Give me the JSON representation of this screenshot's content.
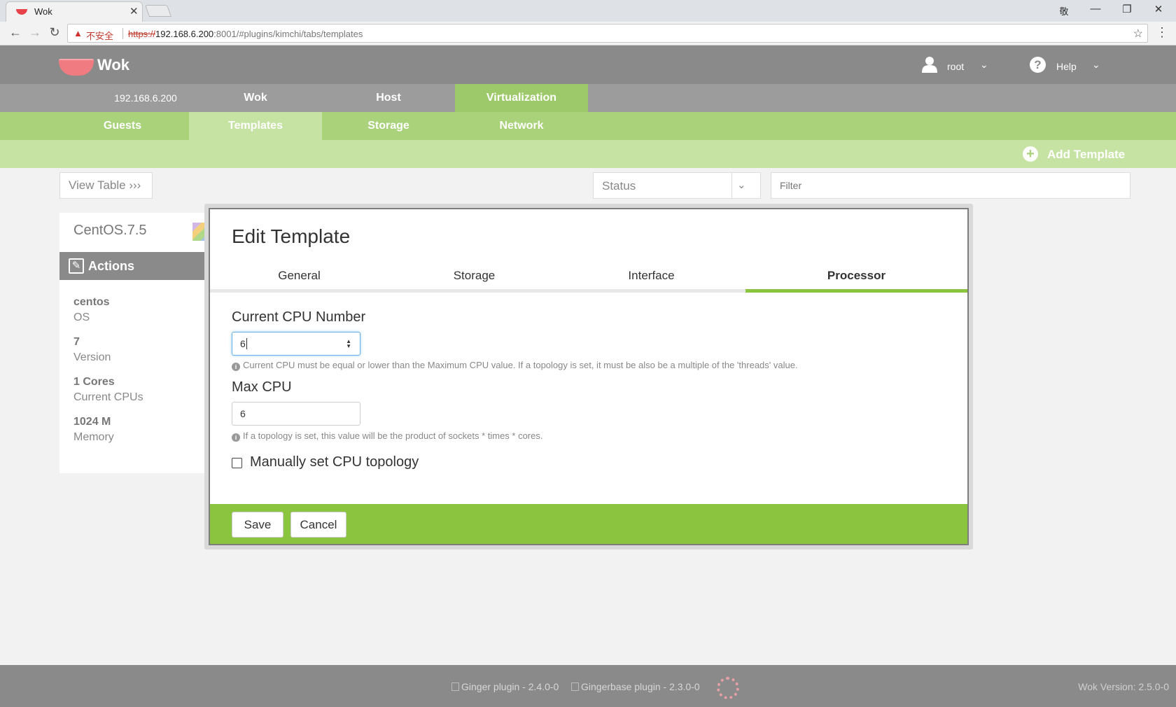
{
  "browser": {
    "tab_title": "Wok",
    "close_glyph": "✕",
    "user_glyph": "敬",
    "security_label": "不安全",
    "url_scheme": "https://",
    "url_host": "192.168.6.200",
    "url_rest": ":8001/#plugins/kimchi/tabs/templates"
  },
  "header": {
    "app_name": "Wok",
    "user": "root",
    "help": "Help"
  },
  "top_tabs": [
    {
      "label": "192.168.6.200"
    },
    {
      "label": "Wok"
    },
    {
      "label": "Host"
    },
    {
      "label": "Virtualization"
    }
  ],
  "sub_tabs": [
    {
      "label": "Guests"
    },
    {
      "label": "Templates"
    },
    {
      "label": "Storage"
    },
    {
      "label": "Network"
    }
  ],
  "toolbar": {
    "add_template": "Add Template"
  },
  "filters": {
    "view_table": "View Table ›››",
    "status_label": "Status",
    "filter_placeholder": "Filter"
  },
  "template_card": {
    "name": "CentOS.7.5",
    "actions_label": "Actions",
    "specs": [
      {
        "value": "centos",
        "label": "OS"
      },
      {
        "value": "7",
        "label": "Version"
      },
      {
        "value": "1 Cores",
        "label": "Current CPUs"
      },
      {
        "value": "1024 M",
        "label": "Memory"
      }
    ]
  },
  "modal": {
    "title": "Edit Template",
    "tabs": [
      {
        "label": "General"
      },
      {
        "label": "Storage"
      },
      {
        "label": "Interface"
      },
      {
        "label": "Processor"
      }
    ],
    "current_cpu_label": "Current CPU Number",
    "current_cpu_value": "6",
    "current_cpu_help": "Current CPU must be equal or lower than the Maximum CPU value. If a topology is set, it must be also be a multiple of the 'threads' value.",
    "max_cpu_label": "Max CPU",
    "max_cpu_value": "6",
    "max_cpu_help": "If a topology is set, this value will be the product of sockets * times * cores.",
    "topology_label": "Manually set CPU topology",
    "save_label": "Save",
    "cancel_label": "Cancel"
  },
  "footer": {
    "ginger": "Ginger plugin - 2.4.0-0",
    "gingerbase": "Gingerbase plugin - 2.3.0-0",
    "wok_version": "Wok Version: 2.5.0-0"
  },
  "colors": {
    "header_gray": "#8a8a8a",
    "nav_green": "#9ec96a",
    "sub_green": "#a9d27a",
    "light_green": "#c6e3a4",
    "accent_green": "#8bc540",
    "logo_pink": "#f07b80"
  }
}
